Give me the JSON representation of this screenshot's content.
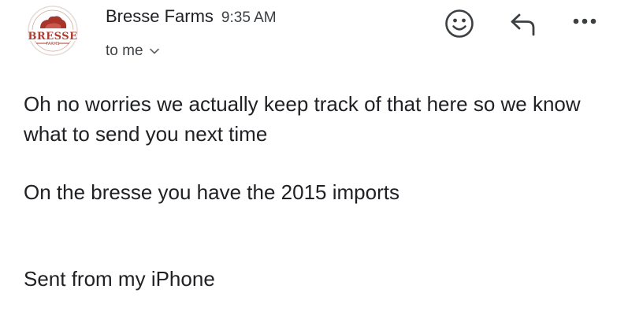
{
  "sender": {
    "name": "Bresse Farms",
    "time": "9:35 AM",
    "avatar_logo_text": "BRESSE",
    "avatar_logo_subtext": "FARMS"
  },
  "recipient": {
    "label": "to me"
  },
  "actions": [
    {
      "name": "react-emoji",
      "icon": "smiley-face-icon"
    },
    {
      "name": "reply",
      "icon": "reply-arrow-icon"
    },
    {
      "name": "more",
      "icon": "more-dots-icon"
    }
  ],
  "message": {
    "paragraphs": [
      "Oh no worries we actually keep track of that here so we know what to send you next time",
      "On the bresse you have the 2015 imports",
      "Sent from my iPhone"
    ]
  },
  "colors": {
    "text_primary": "#202124",
    "text_secondary": "#3c4043",
    "logo_red": "#b23a2f",
    "background": "#ffffff"
  }
}
